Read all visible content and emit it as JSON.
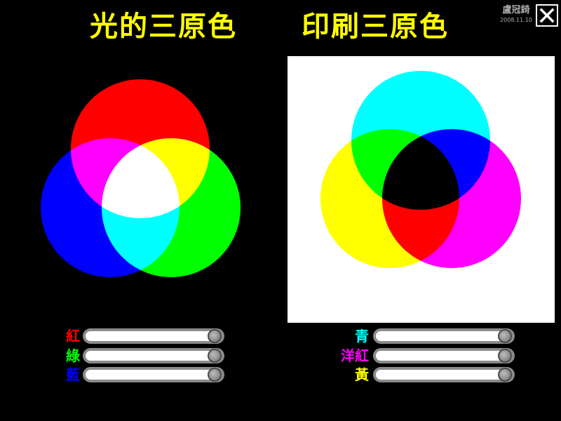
{
  "titles": {
    "light": "光的三原色",
    "print": "印刷三原色"
  },
  "author": {
    "name": "盧冠錡",
    "date": "2008.11.10"
  },
  "close_icon": "close-icon",
  "light_sliders": [
    {
      "label": "紅",
      "color": "#ff0000",
      "value": 1.0
    },
    {
      "label": "綠",
      "color": "#00ff00",
      "value": 1.0
    },
    {
      "label": "藍",
      "color": "#0000ff",
      "value": 1.0
    }
  ],
  "print_sliders": [
    {
      "label": "青",
      "color": "#00ffff",
      "value": 1.0
    },
    {
      "label": "洋紅",
      "color": "#ff00ff",
      "value": 1.0
    },
    {
      "label": "黃",
      "color": "#ffff00",
      "value": 1.0
    }
  ],
  "colors": {
    "background": "#000000",
    "title": "#ffff00",
    "print_panel_bg": "#ffffff",
    "red": "#ff0000",
    "green": "#00ff00",
    "blue": "#0000ff",
    "cyan": "#00ffff",
    "magenta": "#ff00ff",
    "yellow": "#ffff00"
  }
}
